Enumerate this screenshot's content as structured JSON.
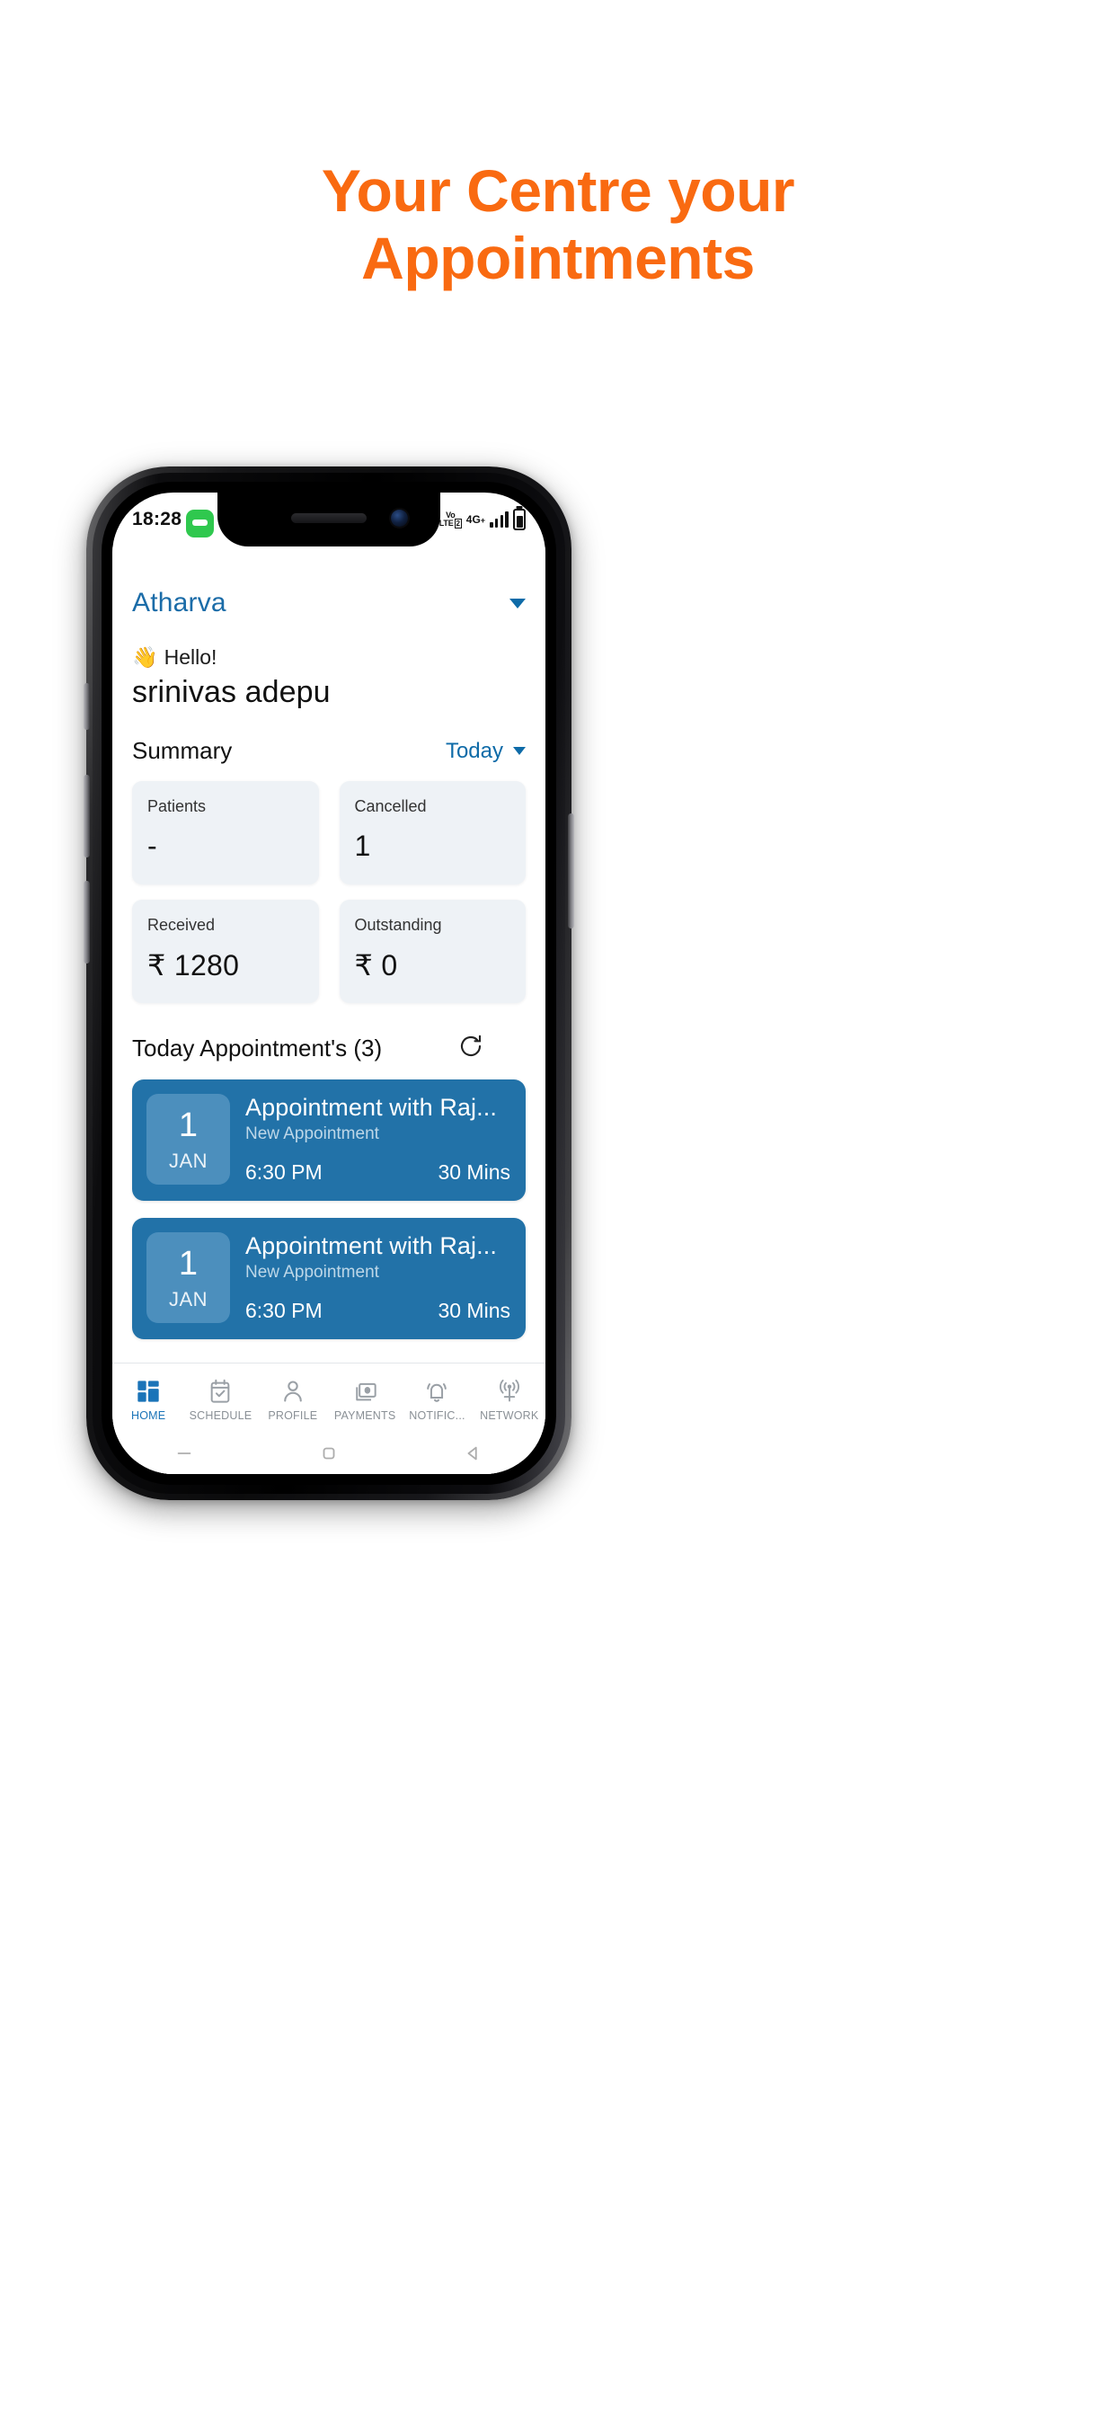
{
  "marketing": {
    "headline_line1": "Your Centre your",
    "headline_line2": "Appointments",
    "accent_color": "#F96A11"
  },
  "status_bar": {
    "time": "18:28",
    "notification_icon": "green-message-icon",
    "volte_line1": "Vo",
    "volte_line2": "LTE",
    "sim_slot": "2",
    "network": "4G",
    "network_plus": "+",
    "signal_bars": 4,
    "battery_icon": "battery-icon"
  },
  "header": {
    "centre_name": "Atharva",
    "centre_dropdown_icon": "chevron-down-icon"
  },
  "greeting": {
    "wave_emoji": "👋",
    "hello": "Hello!",
    "user_name": "srinivas adepu"
  },
  "summary": {
    "title": "Summary",
    "period_label": "Today",
    "period_icon": "chevron-down-icon",
    "cards": [
      {
        "label": "Patients",
        "value": "-"
      },
      {
        "label": "Cancelled",
        "value": "1"
      },
      {
        "label": "Received",
        "value": "₹ 1280"
      },
      {
        "label": "Outstanding",
        "value": "₹ 0"
      }
    ]
  },
  "appointments_section": {
    "title": "Today Appointment's (3)",
    "refresh_icon": "refresh-icon",
    "items": [
      {
        "day": "1",
        "month": "JAN",
        "title": "Appointment with Raj...",
        "subtitle": "New Appointment",
        "time": "6:30 PM",
        "duration": "30 Mins"
      },
      {
        "day": "1",
        "month": "JAN",
        "title": "Appointment with Raj...",
        "subtitle": "New Appointment",
        "time": "6:30 PM",
        "duration": "30 Mins"
      }
    ]
  },
  "bottom_nav": {
    "items": [
      {
        "label": "HOME",
        "icon": "dashboard-grid-icon",
        "active": true
      },
      {
        "label": "SCHEDULE",
        "icon": "calendar-check-icon",
        "active": false
      },
      {
        "label": "PROFILE",
        "icon": "person-icon",
        "active": false
      },
      {
        "label": "PAYMENTS",
        "icon": "money-icon",
        "active": false
      },
      {
        "label": "NOTIFIC...",
        "icon": "bell-icon",
        "active": false
      },
      {
        "label": "NETWORK",
        "icon": "broadcast-icon",
        "active": false
      }
    ],
    "active_color": "#1B74B8",
    "inactive_color": "#8A9096"
  },
  "system_nav": {
    "recents_icon": "recents-icon",
    "home_icon": "home-square-icon",
    "back_icon": "back-triangle-icon"
  },
  "theme": {
    "card_blue": "#2272A8",
    "date_box_blue": "#4C8FBD",
    "stat_card_bg": "#EEF2F6",
    "link_blue": "#0E6BA8"
  }
}
